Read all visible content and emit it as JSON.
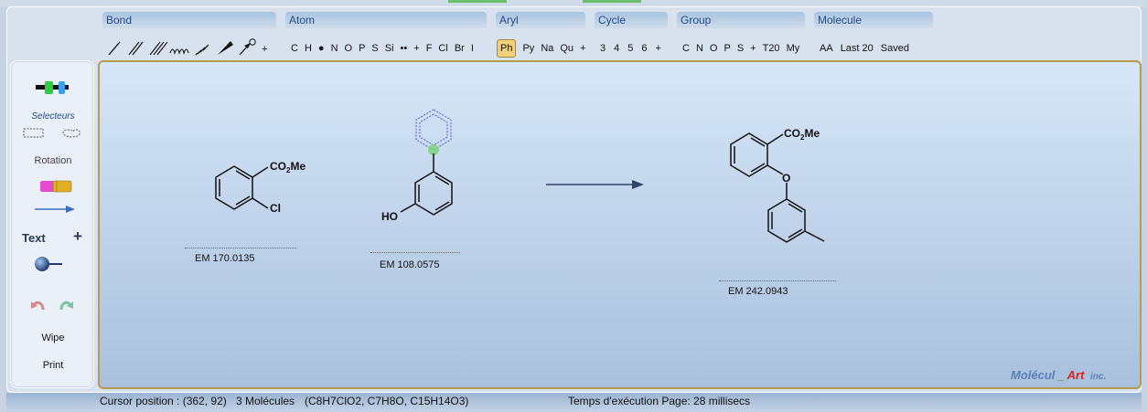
{
  "toolbar": {
    "groups": [
      {
        "label": "Bond"
      },
      {
        "label": "Atom"
      },
      {
        "label": "Aryl"
      },
      {
        "label": "Cycle"
      },
      {
        "label": "Group"
      },
      {
        "label": "Molecule"
      }
    ],
    "bond_tools": {
      "plus": "+"
    },
    "atom_tools": [
      "C",
      "H",
      "●",
      "N",
      "O",
      "P",
      "S",
      "Si",
      "••",
      "+",
      "F",
      "Cl",
      "Br",
      "I"
    ],
    "aryl_tools": [
      "Ph",
      "Py",
      "Na",
      "Qu",
      "+"
    ],
    "aryl_active": "Ph",
    "cycle_tools": [
      "3",
      "4",
      "5",
      "6",
      "+"
    ],
    "group_tools": [
      "C",
      "N",
      "O",
      "P",
      "S",
      "+",
      "T20",
      "My"
    ],
    "molecule_tools": [
      "AA",
      "Last 20",
      "Saved"
    ]
  },
  "sidebar": {
    "selecteurs": "Selecteurs",
    "rotation": "Rotation",
    "text": "Text",
    "text_plus": "+",
    "wipe": "Wipe",
    "print": "Print"
  },
  "canvas": {
    "molecules": [
      {
        "group_label": "CO2Me",
        "substituent": "Cl",
        "em": "EM 170.0135"
      },
      {
        "substituent": "HO",
        "em": "EM 108.0575"
      },
      {
        "group_label": "CO2Me",
        "linker": "O",
        "em": "EM 242.0943"
      }
    ],
    "watermark": {
      "part1": "Molécul",
      "sep": "_",
      "part2": "Art",
      "part3": "inc."
    }
  },
  "status": {
    "cursor": "Cursor position : (362, 92)",
    "count": "3 Molécules",
    "formulas": "(C8H7ClO2, C7H8O, C15H14O3)",
    "timing": "Temps d'exécution Page: 28 millisecs"
  },
  "colors": {
    "accent": "#1f4b8a",
    "canvas_border": "#b89a52",
    "watermark_blue": "#5b7fb7",
    "watermark_green": "#2ea043",
    "watermark_red": "#e0201c"
  }
}
